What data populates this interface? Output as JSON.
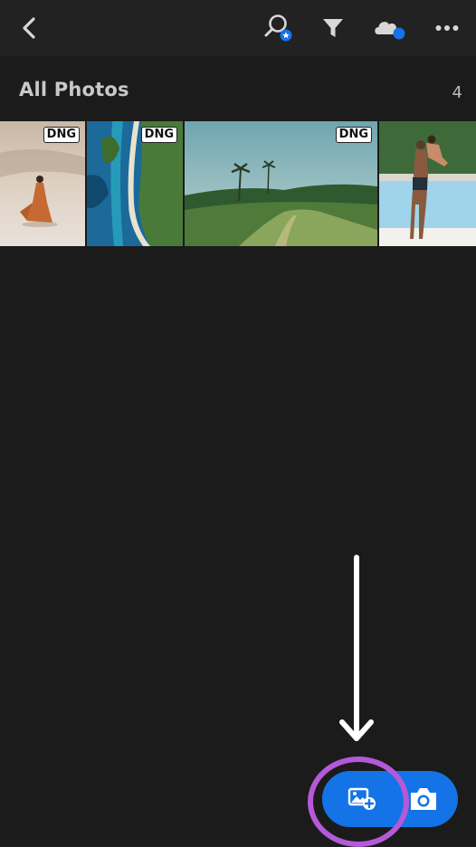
{
  "app": {
    "accent_color": "#1473e6",
    "highlight_color": "#b35ad8"
  },
  "toolbar": {
    "back_icon": "chevron-left-icon",
    "search_icon": "search-star-icon",
    "filter_icon": "filter-icon",
    "cloud_icon": "cloud-sync-icon",
    "more_icon": "more-horizontal-icon"
  },
  "section": {
    "title": "All Photos",
    "count": "4"
  },
  "photos": [
    {
      "badge": "DNG",
      "subject": "woman in orange dress on sand"
    },
    {
      "badge": "DNG",
      "subject": "aerial coastline cliff"
    },
    {
      "badge": "DNG",
      "subject": "green hills with palm trees"
    },
    {
      "badge": "",
      "subject": "couple embracing by pool"
    }
  ],
  "actions": {
    "add_photos_icon": "add-photo-icon",
    "camera_icon": "camera-icon"
  }
}
